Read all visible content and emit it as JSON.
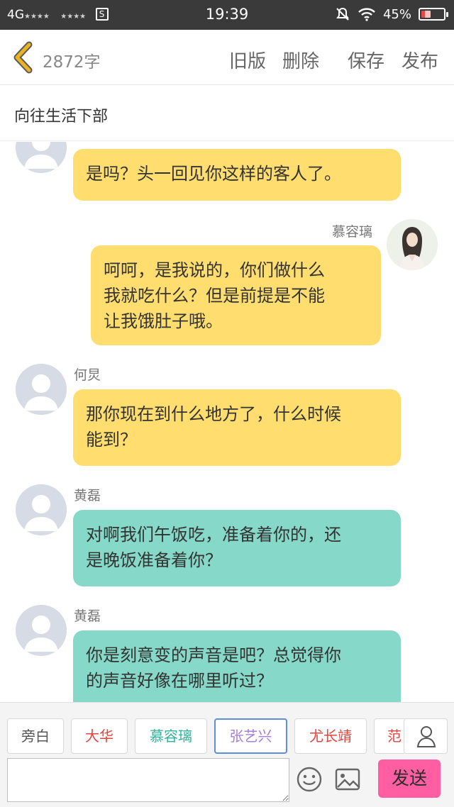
{
  "status_bar": {
    "network": "4G",
    "signal_stars": "★★★★",
    "signal_stars2": "★★★★",
    "sim_icon": "S",
    "time": "19:39",
    "battery": "45%",
    "battery_level": 0.45
  },
  "header": {
    "word_count": "2872字",
    "old_version": "旧版",
    "delete": "删除",
    "save": "保存",
    "publish": "发布"
  },
  "title": "向往生活下部",
  "messages": [
    {
      "side": "left",
      "speaker": "",
      "text": "是吗？头一回见你这样的客人了。",
      "color": "yellow"
    },
    {
      "side": "right",
      "speaker": "慕容璃",
      "text": "呵呵，是我说的，你们做什么我就吃什么？但是前提是不能让我饿肚子哦。",
      "color": "yellow"
    },
    {
      "side": "left",
      "speaker": "何炅",
      "text": "那你现在到什么地方了，什么时候能到？",
      "color": "yellow"
    },
    {
      "side": "left",
      "speaker": "黄磊",
      "text": "对啊我们午饭吃，准备着你的，还是晚饭准备着你？",
      "color": "teal"
    },
    {
      "side": "left",
      "speaker": "黄磊",
      "text": "你是刻意变的声音是吧？总觉得你的声音好像在哪里听过？",
      "color": "teal"
    }
  ],
  "message_lines": [
    [
      "是吗？头一回见你这样的客人了。"
    ],
    [
      "呵呵，是我说的，你们做什么",
      "我就吃什么？但是前提是不能",
      "让我饿肚子哦。"
    ],
    [
      "那你现在到什么地方了，什么时候",
      "能到？"
    ],
    [
      "对啊我们午饭吃，准备着你的，还",
      "是晚饭准备着你？"
    ],
    [
      "你是刻意变的声音是吧？总觉得你",
      "的声音好像在哪里听过？"
    ]
  ],
  "roles": [
    {
      "label": "旁白",
      "color": "#555555"
    },
    {
      "label": "大华",
      "color": "#e0443e"
    },
    {
      "label": "慕容璃",
      "color": "#2fb39a"
    },
    {
      "label": "张艺兴",
      "color": "#a77fd6"
    },
    {
      "label": "尤长靖",
      "color": "#e0443e"
    },
    {
      "label": "范",
      "color": "#e0443e"
    }
  ],
  "input": {
    "placeholder": ""
  },
  "send_label": "发送",
  "colors": {
    "yellow_bubble": "#ffdd6e",
    "teal_bubble": "#86d8c9",
    "send_button": "#ff5fa2",
    "back_arrow": "#e8b422"
  }
}
